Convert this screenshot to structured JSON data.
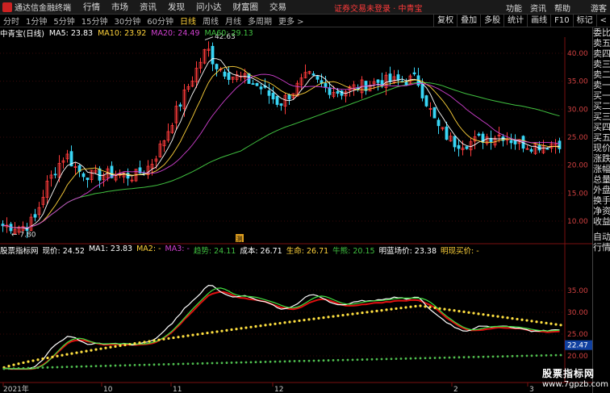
{
  "titlebar": {
    "app": "通达信金融终端",
    "menu": [
      "行情",
      "市场",
      "资讯",
      "发现",
      "问小达",
      "财富圈",
      "交易"
    ],
    "notice": "证券交易未登录",
    "stock": "中青宝",
    "right": [
      "功能",
      "资讯",
      "帮助"
    ],
    "user": "游客"
  },
  "toolbar": {
    "periods": [
      "分时",
      "1分钟",
      "5分钟",
      "15分钟",
      "30分钟",
      "60分钟",
      "日线",
      "周线",
      "月线",
      "多周期",
      "更多 >"
    ],
    "active": "日线",
    "right": [
      "复权",
      "叠加",
      "多股",
      "统计",
      "画线",
      "F10",
      "标记",
      "<"
    ]
  },
  "info": {
    "name": "中青宝(日线)",
    "ma5": "MA5: 23.83",
    "ma10": "MA10: 23.92",
    "ma20": "MA20: 24.49",
    "ma60": "MA60: 29.13"
  },
  "price_axis": [
    "40.00",
    "35.00",
    "30.00",
    "25.00",
    "20.00",
    "15.00",
    "10.00"
  ],
  "annotations": {
    "high": "42.63",
    "low": "7.80",
    "marker": "测"
  },
  "indicator": {
    "name": "股票指标网",
    "xian": "现价: 24.52",
    "ma1": "MA1: 23.83",
    "ma2": "MA2: -",
    "ma3": "MA3: -",
    "trend": "趋势: 24.11",
    "cost": "成本: 26.71",
    "life": "生命: 26.71",
    "bull": "牛熊: 20.15",
    "market": "明蓝场价: 23.38",
    "buy": "明现买价: -"
  },
  "ind_axis": [
    "35.00",
    "30.00",
    "25.00",
    "20.00"
  ],
  "ind_value": "22.47",
  "x_labels": [
    "2021年",
    "10",
    "11",
    "12",
    "2",
    "3"
  ],
  "right_panel": [
    "委比",
    "卖五",
    "卖四",
    "卖三",
    "卖二",
    "卖一",
    "买一",
    "买二",
    "买三",
    "买四",
    "买五",
    "现价",
    "涨跌",
    "涨幅",
    "总量",
    "外盘",
    "换手",
    "净资",
    "收益",
    "自动",
    "行情"
  ],
  "watermark": {
    "line1": "股票指标网",
    "line2": "www.7gpzb.com"
  },
  "colors": {
    "ma5": "#ffffff",
    "ma10": "#ffd23a",
    "ma20": "#d040d0",
    "ma60": "#40c040",
    "up": "#ff3b3b",
    "down": "#39d5f5"
  }
}
